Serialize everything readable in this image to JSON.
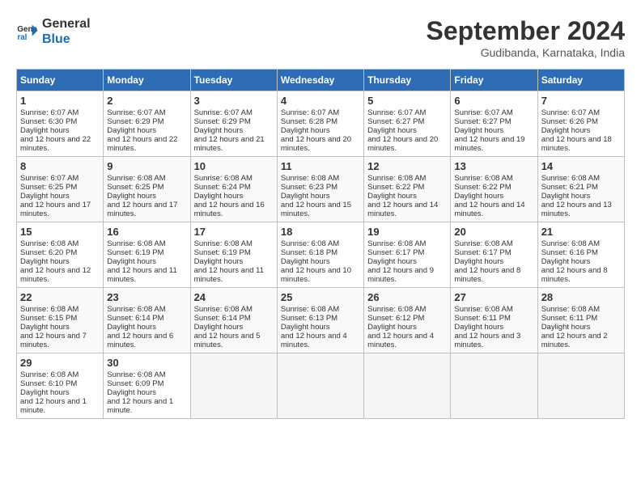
{
  "logo": {
    "line1": "General",
    "line2": "Blue"
  },
  "title": "September 2024",
  "location": "Gudibanda, Karnataka, India",
  "days_of_week": [
    "Sunday",
    "Monday",
    "Tuesday",
    "Wednesday",
    "Thursday",
    "Friday",
    "Saturday"
  ],
  "weeks": [
    [
      {
        "num": "1",
        "sunrise": "6:07 AM",
        "sunset": "6:30 PM",
        "daylight": "12 hours and 22 minutes."
      },
      {
        "num": "2",
        "sunrise": "6:07 AM",
        "sunset": "6:29 PM",
        "daylight": "12 hours and 22 minutes."
      },
      {
        "num": "3",
        "sunrise": "6:07 AM",
        "sunset": "6:29 PM",
        "daylight": "12 hours and 21 minutes."
      },
      {
        "num": "4",
        "sunrise": "6:07 AM",
        "sunset": "6:28 PM",
        "daylight": "12 hours and 20 minutes."
      },
      {
        "num": "5",
        "sunrise": "6:07 AM",
        "sunset": "6:27 PM",
        "daylight": "12 hours and 20 minutes."
      },
      {
        "num": "6",
        "sunrise": "6:07 AM",
        "sunset": "6:27 PM",
        "daylight": "12 hours and 19 minutes."
      },
      {
        "num": "7",
        "sunrise": "6:07 AM",
        "sunset": "6:26 PM",
        "daylight": "12 hours and 18 minutes."
      }
    ],
    [
      {
        "num": "8",
        "sunrise": "6:07 AM",
        "sunset": "6:25 PM",
        "daylight": "12 hours and 17 minutes."
      },
      {
        "num": "9",
        "sunrise": "6:08 AM",
        "sunset": "6:25 PM",
        "daylight": "12 hours and 17 minutes."
      },
      {
        "num": "10",
        "sunrise": "6:08 AM",
        "sunset": "6:24 PM",
        "daylight": "12 hours and 16 minutes."
      },
      {
        "num": "11",
        "sunrise": "6:08 AM",
        "sunset": "6:23 PM",
        "daylight": "12 hours and 15 minutes."
      },
      {
        "num": "12",
        "sunrise": "6:08 AM",
        "sunset": "6:22 PM",
        "daylight": "12 hours and 14 minutes."
      },
      {
        "num": "13",
        "sunrise": "6:08 AM",
        "sunset": "6:22 PM",
        "daylight": "12 hours and 14 minutes."
      },
      {
        "num": "14",
        "sunrise": "6:08 AM",
        "sunset": "6:21 PM",
        "daylight": "12 hours and 13 minutes."
      }
    ],
    [
      {
        "num": "15",
        "sunrise": "6:08 AM",
        "sunset": "6:20 PM",
        "daylight": "12 hours and 12 minutes."
      },
      {
        "num": "16",
        "sunrise": "6:08 AM",
        "sunset": "6:19 PM",
        "daylight": "12 hours and 11 minutes."
      },
      {
        "num": "17",
        "sunrise": "6:08 AM",
        "sunset": "6:19 PM",
        "daylight": "12 hours and 11 minutes."
      },
      {
        "num": "18",
        "sunrise": "6:08 AM",
        "sunset": "6:18 PM",
        "daylight": "12 hours and 10 minutes."
      },
      {
        "num": "19",
        "sunrise": "6:08 AM",
        "sunset": "6:17 PM",
        "daylight": "12 hours and 9 minutes."
      },
      {
        "num": "20",
        "sunrise": "6:08 AM",
        "sunset": "6:17 PM",
        "daylight": "12 hours and 8 minutes."
      },
      {
        "num": "21",
        "sunrise": "6:08 AM",
        "sunset": "6:16 PM",
        "daylight": "12 hours and 8 minutes."
      }
    ],
    [
      {
        "num": "22",
        "sunrise": "6:08 AM",
        "sunset": "6:15 PM",
        "daylight": "12 hours and 7 minutes."
      },
      {
        "num": "23",
        "sunrise": "6:08 AM",
        "sunset": "6:14 PM",
        "daylight": "12 hours and 6 minutes."
      },
      {
        "num": "24",
        "sunrise": "6:08 AM",
        "sunset": "6:14 PM",
        "daylight": "12 hours and 5 minutes."
      },
      {
        "num": "25",
        "sunrise": "6:08 AM",
        "sunset": "6:13 PM",
        "daylight": "12 hours and 4 minutes."
      },
      {
        "num": "26",
        "sunrise": "6:08 AM",
        "sunset": "6:12 PM",
        "daylight": "12 hours and 4 minutes."
      },
      {
        "num": "27",
        "sunrise": "6:08 AM",
        "sunset": "6:11 PM",
        "daylight": "12 hours and 3 minutes."
      },
      {
        "num": "28",
        "sunrise": "6:08 AM",
        "sunset": "6:11 PM",
        "daylight": "12 hours and 2 minutes."
      }
    ],
    [
      {
        "num": "29",
        "sunrise": "6:08 AM",
        "sunset": "6:10 PM",
        "daylight": "12 hours and 1 minute."
      },
      {
        "num": "30",
        "sunrise": "6:08 AM",
        "sunset": "6:09 PM",
        "daylight": "12 hours and 1 minute."
      },
      null,
      null,
      null,
      null,
      null
    ]
  ]
}
